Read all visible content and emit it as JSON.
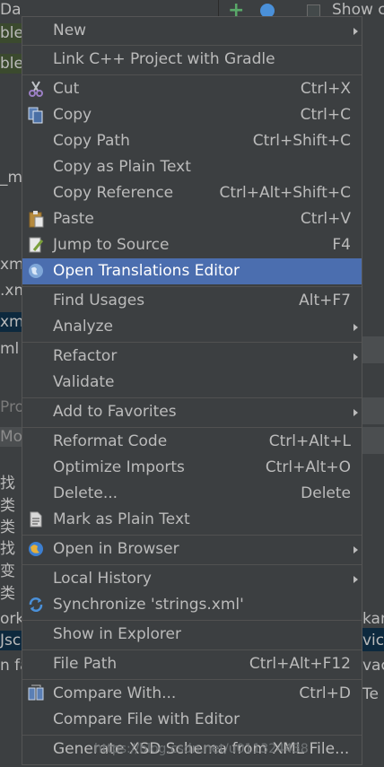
{
  "background": {
    "left_fragments": [
      {
        "text": "Dao",
        "style": ""
      },
      {
        "text": "ble.",
        "style": "green"
      },
      {
        "text": "ble.",
        "style": "green"
      },
      {
        "text": "_m",
        "style": ""
      },
      {
        "text": "xml",
        "style": ""
      },
      {
        "text": ".xm",
        "style": ""
      },
      {
        "text": "xm",
        "style": "sel"
      },
      {
        "text": "ml",
        "style": ""
      },
      {
        "text": "Proj",
        "style": "dim"
      },
      {
        "text": "Mod",
        "style": "hdr"
      },
      {
        "text": "找",
        "style": ""
      },
      {
        "text": "类",
        "style": ""
      },
      {
        "text": "类",
        "style": ""
      },
      {
        "text": "找",
        "style": ""
      },
      {
        "text": "变",
        "style": ""
      },
      {
        "text": "类",
        "style": ""
      },
      {
        "text": "ork",
        "style": ""
      },
      {
        "text": "Jsc",
        "style": "sel"
      },
      {
        "text": "n fa",
        "style": ""
      }
    ],
    "right_fragments": [
      {
        "text": "kam"
      },
      {
        "text": "vice"
      },
      {
        "text": "vac"
      },
      {
        "text": "Te"
      }
    ],
    "top_toolbar": {
      "show_label": "Show c"
    }
  },
  "menu": {
    "items": [
      {
        "label": "New",
        "shortcut": "",
        "submenu": true,
        "icon": ""
      },
      {
        "label": "Link C++ Project with Gradle",
        "shortcut": "",
        "submenu": false,
        "icon": ""
      },
      {
        "label": "Cut",
        "shortcut": "Ctrl+X",
        "submenu": false,
        "icon": "scissors-icon"
      },
      {
        "label": "Copy",
        "shortcut": "Ctrl+C",
        "submenu": false,
        "icon": "copy-icon"
      },
      {
        "label": "Copy Path",
        "shortcut": "Ctrl+Shift+C",
        "submenu": false,
        "icon": ""
      },
      {
        "label": "Copy as Plain Text",
        "shortcut": "",
        "submenu": false,
        "icon": ""
      },
      {
        "label": "Copy Reference",
        "shortcut": "Ctrl+Alt+Shift+C",
        "submenu": false,
        "icon": ""
      },
      {
        "label": "Paste",
        "shortcut": "Ctrl+V",
        "submenu": false,
        "icon": "paste-icon"
      },
      {
        "label": "Jump to Source",
        "shortcut": "F4",
        "submenu": false,
        "icon": "edit-icon"
      },
      {
        "label": "Open Translations Editor",
        "shortcut": "",
        "submenu": false,
        "icon": "globe-icon",
        "selected": true
      },
      {
        "label": "Find Usages",
        "shortcut": "Alt+F7",
        "submenu": false,
        "icon": ""
      },
      {
        "label": "Analyze",
        "shortcut": "",
        "submenu": true,
        "icon": ""
      },
      {
        "label": "Refactor",
        "shortcut": "",
        "submenu": true,
        "icon": ""
      },
      {
        "label": "Validate",
        "shortcut": "",
        "submenu": false,
        "icon": ""
      },
      {
        "label": "Add to Favorites",
        "shortcut": "",
        "submenu": true,
        "icon": ""
      },
      {
        "label": "Reformat Code",
        "shortcut": "Ctrl+Alt+L",
        "submenu": false,
        "icon": ""
      },
      {
        "label": "Optimize Imports",
        "shortcut": "Ctrl+Alt+O",
        "submenu": false,
        "icon": ""
      },
      {
        "label": "Delete...",
        "shortcut": "Delete",
        "submenu": false,
        "icon": ""
      },
      {
        "label": "Mark as Plain Text",
        "shortcut": "",
        "submenu": false,
        "icon": "document-icon"
      },
      {
        "label": "Open in Browser",
        "shortcut": "",
        "submenu": true,
        "icon": "browser-globe-icon"
      },
      {
        "label": "Local History",
        "shortcut": "",
        "submenu": true,
        "icon": ""
      },
      {
        "label": "Synchronize 'strings.xml'",
        "shortcut": "",
        "submenu": false,
        "icon": "sync-icon"
      },
      {
        "label": "Show in Explorer",
        "shortcut": "",
        "submenu": false,
        "icon": ""
      },
      {
        "label": "File Path",
        "shortcut": "Ctrl+Alt+F12",
        "submenu": false,
        "icon": ""
      },
      {
        "label": "Compare With...",
        "shortcut": "Ctrl+D",
        "submenu": false,
        "icon": "compare-icon"
      },
      {
        "label": "Compare File with Editor",
        "shortcut": "",
        "submenu": false,
        "icon": ""
      },
      {
        "label": "Generate XSD Schema from XML File...",
        "shortcut": "",
        "submenu": false,
        "icon": ""
      }
    ],
    "watermark": "https://blog.csdn.net/u011324438"
  }
}
